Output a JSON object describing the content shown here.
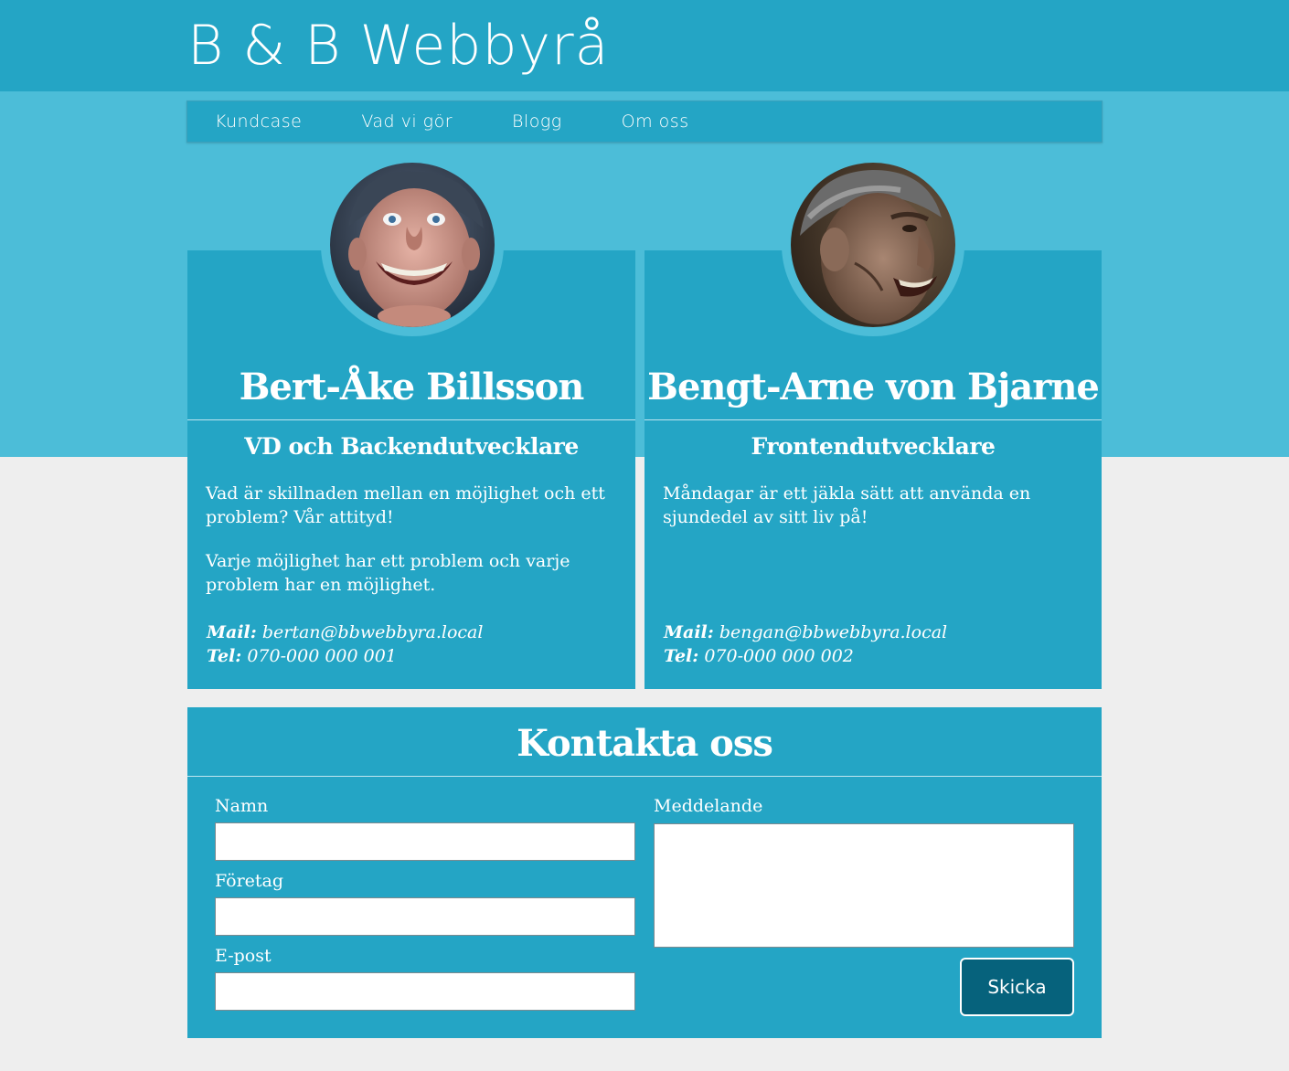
{
  "header": {
    "title": "B & B Webbyrå"
  },
  "nav": {
    "items": [
      {
        "label": "Kundcase"
      },
      {
        "label": "Vad vi gör"
      },
      {
        "label": "Blogg"
      },
      {
        "label": "Om oss"
      }
    ]
  },
  "people": [
    {
      "name": "Bert-Åke Billsson",
      "role": "VD och Backendutvecklare",
      "paragraphs": [
        "Vad är skillnaden mellan en möjlighet och ett problem? Vår attityd!",
        "Varje möjlighet har ett problem och varje problem har en möjlighet."
      ],
      "mail_label": "Mail:",
      "mail": "bertan@bbwebbyra.local",
      "tel_label": "Tel:",
      "tel": "070-000 000 001"
    },
    {
      "name": "Bengt-Arne von Bjarne",
      "role": "Frontendutvecklare",
      "paragraphs": [
        "Måndagar är ett jäkla sätt att använda en sjundedel av sitt liv på!"
      ],
      "mail_label": "Mail:",
      "mail": "bengan@bbwebbyra.local",
      "tel_label": "Tel:",
      "tel": "070-000 000 002"
    }
  ],
  "contact": {
    "title": "Kontakta oss",
    "name_label": "Namn",
    "name_value": "",
    "company_label": "Företag",
    "company_value": "",
    "email_label": "E-post",
    "email_value": "",
    "message_label": "Meddelande",
    "message_value": "",
    "submit_label": "Skicka"
  },
  "colors": {
    "header": "#24a5c5",
    "band": "#4cbdd8",
    "card": "#24a5c5",
    "button": "#06627c",
    "page_bg": "#eeeeee"
  }
}
